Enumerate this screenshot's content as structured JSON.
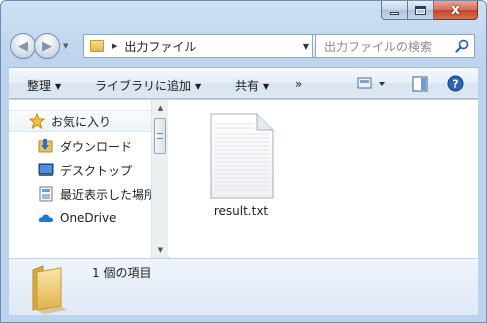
{
  "window": {
    "caption_close_glyph": "x"
  },
  "address": {
    "crumbs": [
      "出力ファイル"
    ],
    "folder_icon": "folder-icon"
  },
  "search": {
    "placeholder": "出力ファイルの検索",
    "icon": "search-icon"
  },
  "toolbar": {
    "organize_label": "整理",
    "library_label": "ライブラリに追加",
    "share_label": "共有",
    "more_label": "»",
    "icons": [
      "view-options-icon",
      "preview-pane-icon",
      "help-icon"
    ]
  },
  "navpane": {
    "favorites_label": "お気に入り",
    "items": [
      {
        "label": "ダウンロード",
        "icon": "downloads-icon"
      },
      {
        "label": "デスクトップ",
        "icon": "desktop-icon"
      },
      {
        "label": "最近表示した場所",
        "icon": "recent-places-icon"
      },
      {
        "label": "OneDrive",
        "icon": "onedrive-icon"
      }
    ]
  },
  "files": [
    {
      "name": "result.txt",
      "icon": "text-file-icon"
    }
  ],
  "details": {
    "item_count": "1 個の項目"
  },
  "colors": {
    "window_frame": "#c2d7ef",
    "close_button": "#c2442a",
    "toolbar": "#e5edf7",
    "folder": "#e3b94b"
  }
}
